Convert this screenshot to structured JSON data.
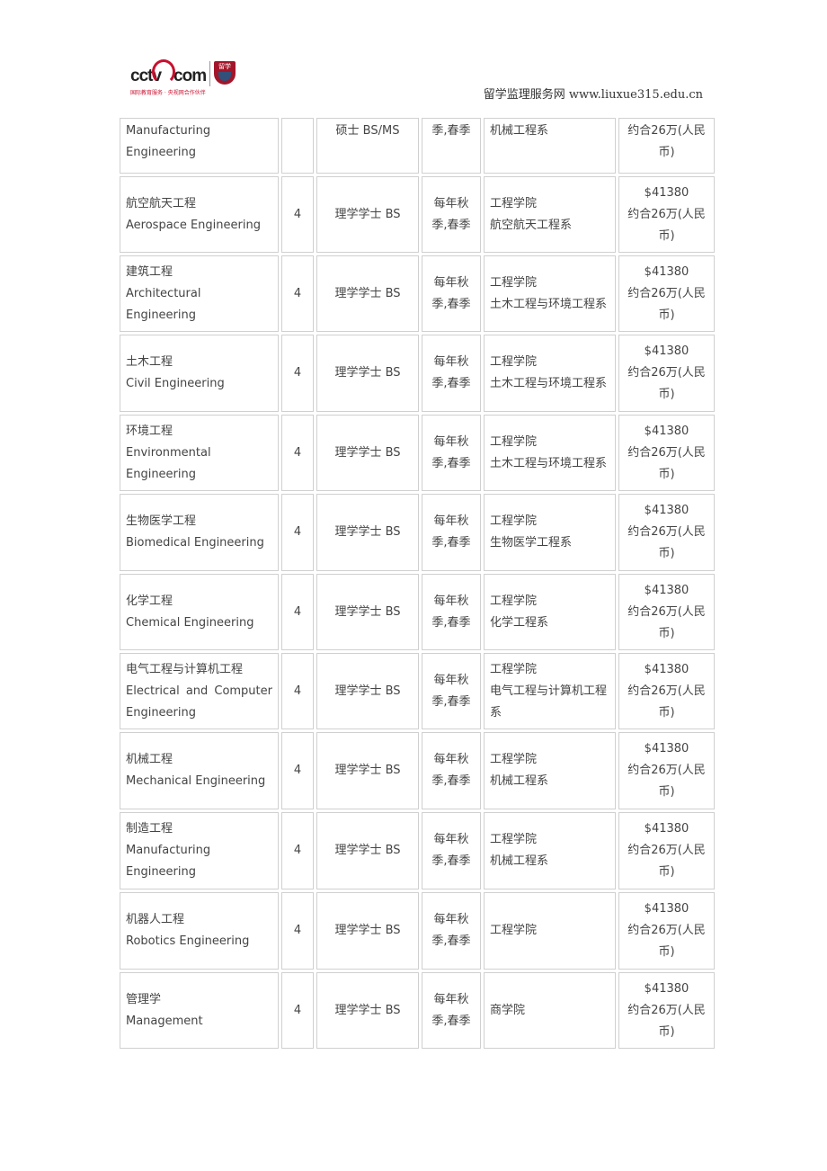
{
  "header": {
    "logo_text": "cctv.com",
    "logo_badge": "留学",
    "logo_tagline": "国际教育服务 · 央视网合作伙伴",
    "site": "留学监理服务网 www.liuxue315.edu.cn"
  },
  "rows": [
    {
      "cn": "",
      "en": "Manufacturing Engineering",
      "years": "",
      "degree": "硕士 BS/MS",
      "term": "季,春季",
      "dept": [
        "机械工程系"
      ],
      "fee": "",
      "rmb": "约合26万(人民币)"
    },
    {
      "cn": "航空航天工程",
      "en": "Aerospace Engineering",
      "years": "4",
      "degree": "理学学士 BS",
      "term": "每年秋季,春季",
      "dept": [
        "工程学院",
        "航空航天工程系"
      ],
      "fee": "$41380",
      "rmb": "约合26万(人民币)"
    },
    {
      "cn": "建筑工程",
      "en": "Architectural Engineering",
      "years": "4",
      "degree": "理学学士 BS",
      "term": "每年秋季,春季",
      "dept": [
        "工程学院",
        "土木工程与环境工程系"
      ],
      "fee": "$41380",
      "rmb": "约合26万(人民币)"
    },
    {
      "cn": "土木工程",
      "en": "Civil Engineering",
      "years": "4",
      "degree": "理学学士 BS",
      "term": "每年秋季,春季",
      "dept": [
        "工程学院",
        "土木工程与环境工程系"
      ],
      "fee": "$41380",
      "rmb": "约合26万(人民币)"
    },
    {
      "cn": "环境工程",
      "en": "Environmental Engineering",
      "years": "4",
      "degree": "理学学士 BS",
      "term": "每年秋季,春季",
      "dept": [
        "工程学院",
        "土木工程与环境工程系"
      ],
      "fee": "$41380",
      "rmb": "约合26万(人民币)"
    },
    {
      "cn": "生物医学工程",
      "en": "Biomedical Engineering",
      "years": "4",
      "degree": "理学学士 BS",
      "term": "每年秋季,春季",
      "dept": [
        "工程学院",
        "生物医学工程系"
      ],
      "fee": "$41380",
      "rmb": "约合26万(人民币)"
    },
    {
      "cn": "化学工程",
      "en": "Chemical Engineering",
      "years": "4",
      "degree": "理学学士 BS",
      "term": "每年秋季,春季",
      "dept": [
        "工程学院",
        "化学工程系"
      ],
      "fee": "$41380",
      "rmb": "约合26万(人民币)"
    },
    {
      "cn": "电气工程与计算机工程",
      "en": "Electrical and Computer Engineering",
      "years": "4",
      "degree": "理学学士 BS",
      "term": "每年秋季,春季",
      "dept": [
        "工程学院",
        "电气工程与计算机工程系"
      ],
      "fee": "$41380",
      "rmb": "约合26万(人民币)"
    },
    {
      "cn": "机械工程",
      "en": "Mechanical Engineering",
      "years": "4",
      "degree": "理学学士 BS",
      "term": "每年秋季,春季",
      "dept": [
        "工程学院",
        "机械工程系"
      ],
      "fee": "$41380",
      "rmb": "约合26万(人民币)"
    },
    {
      "cn": "制造工程",
      "en": "Manufacturing Engineering",
      "years": "4",
      "degree": "理学学士 BS",
      "term": "每年秋季,春季",
      "dept": [
        "工程学院",
        "机械工程系"
      ],
      "fee": "$41380",
      "rmb": "约合26万(人民币)"
    },
    {
      "cn": "机器人工程",
      "en": "Robotics Engineering",
      "years": "4",
      "degree": "理学学士 BS",
      "term": "每年秋季,春季",
      "dept": [
        "工程学院"
      ],
      "fee": "$41380",
      "rmb": "约合26万(人民币)"
    },
    {
      "cn": "管理学",
      "en": "Management",
      "years": "4",
      "degree": "理学学士 BS",
      "term": "每年秋季,春季",
      "dept": [
        "商学院"
      ],
      "fee": "$41380",
      "rmb": "约合26万(人民币)"
    }
  ]
}
